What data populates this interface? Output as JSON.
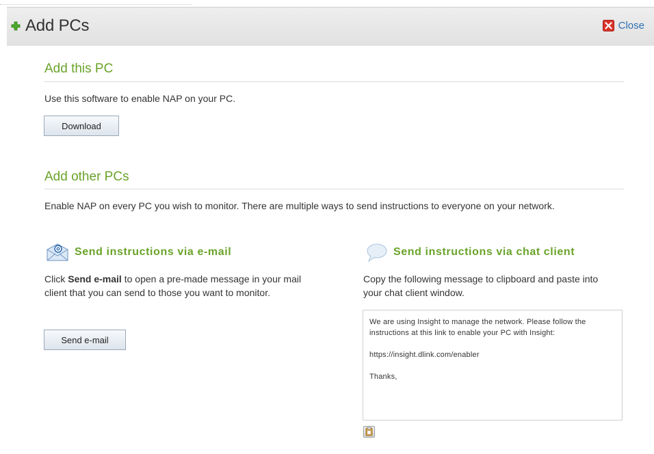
{
  "header": {
    "title": "Add PCs",
    "close_label": "Close"
  },
  "add_this_pc": {
    "title": "Add this PC",
    "description": "Use this software to enable NAP on your PC.",
    "download_label": "Download"
  },
  "add_other_pcs": {
    "title": "Add other PCs",
    "description": "Enable NAP on every PC you wish to monitor. There are multiple ways to send instructions to everyone on your network."
  },
  "email": {
    "title": "Send instructions via e-mail",
    "desc_prefix": "Click ",
    "desc_bold": "Send e-mail",
    "desc_suffix": " to open a pre-made message in your mail client that you can send to those you want to monitor.",
    "button_label": "Send e-mail"
  },
  "chat": {
    "title": "Send instructions via chat client",
    "description": "Copy the following message to clipboard and paste into your chat client window.",
    "message_line1": "We are using Insight to manage the network. Please follow the instructions at this link to enable your PC with Insight:",
    "message_link": "https://insight.dlink.com/enabler",
    "message_thanks": "Thanks,"
  },
  "colors": {
    "accent_green": "#6aa329",
    "link_blue": "#2a6fb0",
    "close_red": "#d9342b"
  }
}
